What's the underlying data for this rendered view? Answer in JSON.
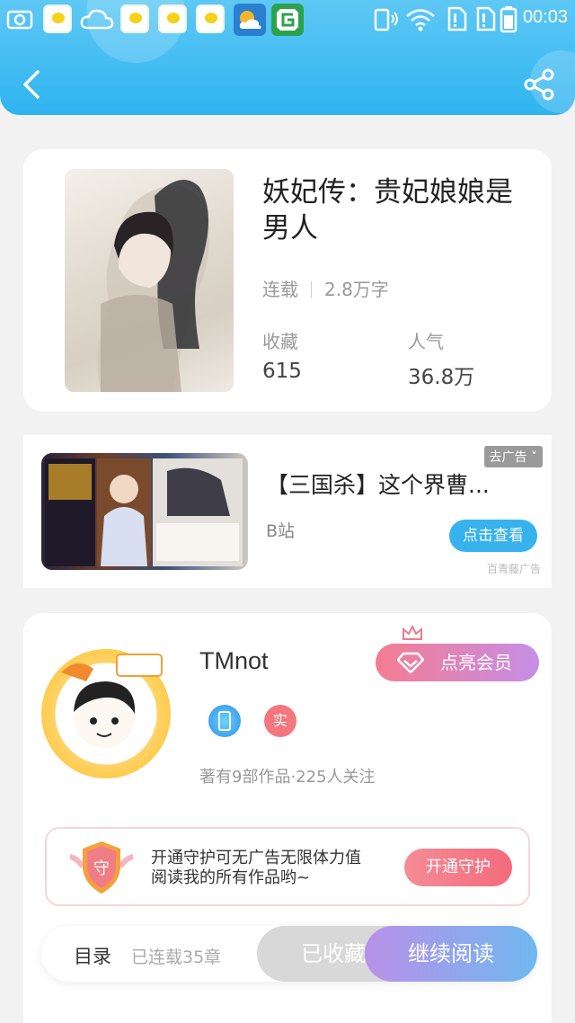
{
  "status_bar": {
    "time": "00:03",
    "icons": [
      "screenshot-icon",
      "app-icon",
      "cloud-icon",
      "app-icon",
      "app-icon",
      "app-icon",
      "weather-icon",
      "game-icon",
      "phone-icon",
      "wifi-icon",
      "sim1-icon",
      "sim2-icon",
      "battery-icon"
    ]
  },
  "header": {
    "back_icon": "chevron-left-icon",
    "share_icon": "share-icon"
  },
  "book": {
    "title": "妖妃传：贵妃娘娘是男人",
    "status": "连载",
    "word_count": "2.8万字",
    "favorites_label": "收藏",
    "favorites_value": "615",
    "popularity_label": "人气",
    "popularity_value": "36.8万"
  },
  "ad": {
    "badge": "去广告 ˅",
    "title": "【三国杀】这个界曹...",
    "source": "B站",
    "button": "点击查看",
    "provider": "百青藤广告"
  },
  "author": {
    "name": "TMnot",
    "vip_button": "点亮会员",
    "real_badge": "实",
    "meta": "著有9部作品·225人关注",
    "guard_text": "开通守护可无广告无限体力值阅读我的所有作品哟~",
    "guard_button": "开通守护",
    "guard_badge": "守"
  },
  "bottom": {
    "toc": "目录",
    "chapters": "已连载35章",
    "collected": "已收藏",
    "continue": "继续阅读"
  },
  "colors": {
    "header": "#2fb4f0",
    "accent_blue": "#38b2ef",
    "vip_gradient_start": "#f57c8f",
    "vip_gradient_end": "#c58ee8"
  }
}
